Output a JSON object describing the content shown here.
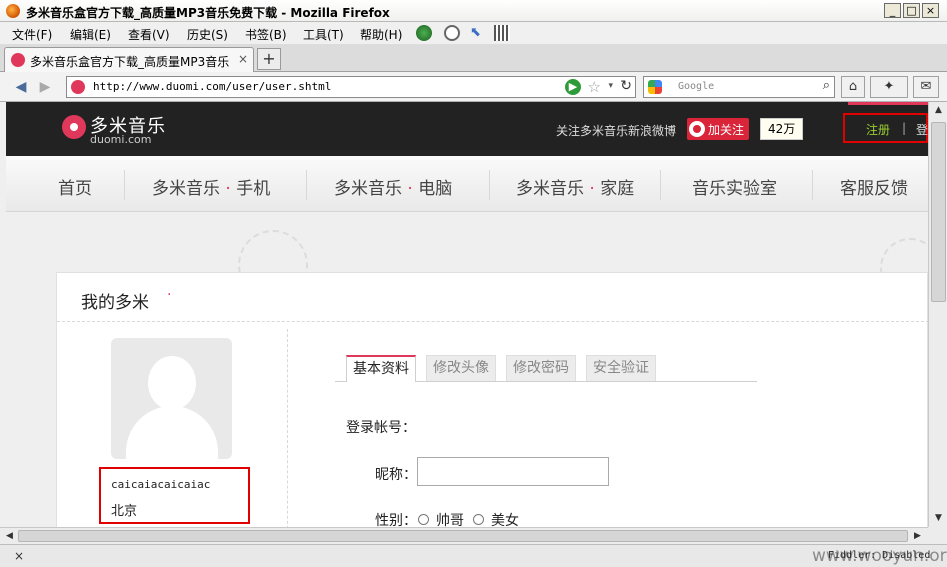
{
  "window": {
    "title": "多米音乐盒官方下载_高质量MP3音乐免费下载 - Mozilla Firefox",
    "min": "_",
    "max": "□",
    "close": "×"
  },
  "menu": {
    "file": "文件(F)",
    "edit": "编辑(E)",
    "view": "查看(V)",
    "history": "历史(S)",
    "bookmarks": "书签(B)",
    "tools": "工具(T)",
    "help": "帮助(H)"
  },
  "tab": {
    "label": "多米音乐盒官方下载_高质量MP3音乐免…",
    "close": "×",
    "new": "+"
  },
  "navbar": {
    "back": "◀",
    "forward": "▶",
    "url": "http://www.duomi.com/user/user.shtml",
    "search_placeholder": "Google",
    "go": "▶",
    "star": "☆",
    "dropdown": "▾",
    "reload": "↻",
    "search_icon": "⌕",
    "home": "⌂",
    "addon": "✦",
    "mail": "✉"
  },
  "site": {
    "logo_cn": "多米音乐",
    "logo_en": "duomi.com",
    "follow_text": "关注多米音乐新浪微博",
    "weibo_label": "加关注",
    "follower_count": "42万",
    "register": "注册",
    "separator": "|",
    "login": "登",
    "nav": [
      {
        "label": "首页",
        "pre": "",
        "post": ""
      },
      {
        "label": "",
        "pre": "多米音乐",
        "post": "手机"
      },
      {
        "label": "",
        "pre": "多米音乐",
        "post": "电脑"
      },
      {
        "label": "",
        "pre": "多米音乐",
        "post": "家庭"
      },
      {
        "label": "音乐实验室",
        "pre": "",
        "post": ""
      },
      {
        "label": "客服反馈",
        "pre": "",
        "post": ""
      }
    ],
    "nav_dot": "·"
  },
  "profile": {
    "title": "我的多米",
    "title_dot": "·",
    "username": "caicaiacaicaiac",
    "location": "北京",
    "tabs": [
      "基本资料",
      "修改头像",
      "修改密码",
      "安全验证"
    ],
    "active_tab": 0,
    "account_label": "登录帐号：",
    "nickname_label": "昵称：",
    "nickname_value": "",
    "gender_label": "性别：",
    "gender_options": [
      "帅哥",
      "美女"
    ]
  },
  "statusbar": {
    "close": "×",
    "fiddler": "Fiddler: Disabled",
    "watermark": "www.wooyun.org"
  },
  "colors": {
    "brand": "#e0385a",
    "header_bg": "#222222",
    "highlight_box": "#e00000",
    "register_link": "#9acd32"
  },
  "icons": {
    "logo": "duomi-logo-icon",
    "weibo": "weibo-icon",
    "avatar": "default-avatar-icon"
  }
}
